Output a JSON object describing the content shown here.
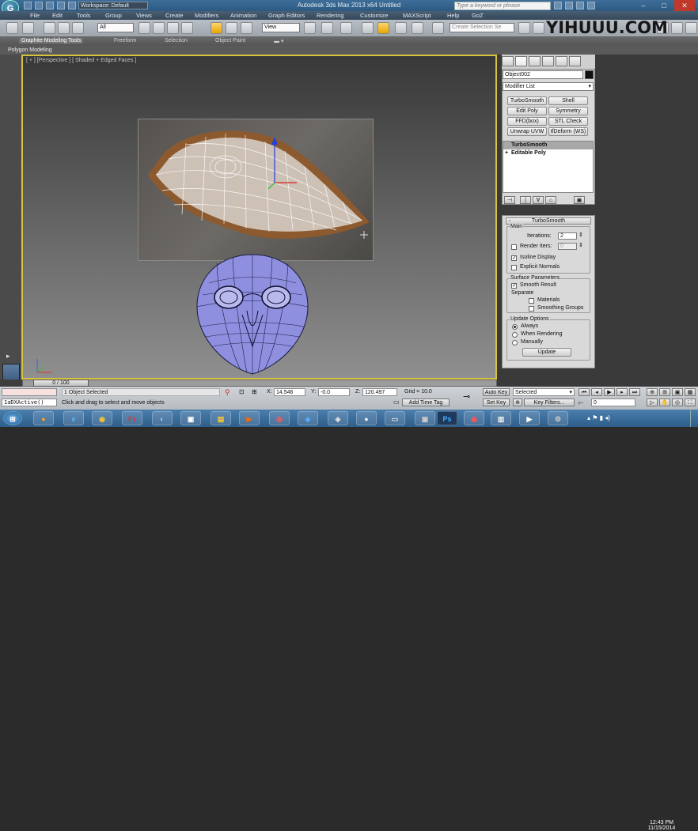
{
  "titlebar": {
    "title": "Autodesk 3ds Max  2013 x64      Untitled",
    "workspace": "Workspace: Default",
    "search_placeholder": "Type a keyword or phrase",
    "app_icon": "3ds-max-logo-icon"
  },
  "menus": [
    "File",
    "Edit",
    "Tools",
    "Group",
    "Views",
    "Create",
    "Modifiers",
    "Animation",
    "Graph Editors",
    "Rendering",
    "Customize",
    "MAXScript",
    "Help",
    "GoZ"
  ],
  "toolbar": {
    "selection_filter": "All",
    "ref_coord": "View",
    "named_selection_placeholder": "Create Selection Se"
  },
  "watermark": "YIHUUU.COM",
  "ribbon": {
    "tabs": [
      "Graphite Modeling Tools",
      "Freeform",
      "Selection",
      "Object Paint"
    ],
    "subtitle": "Polygon Modeling"
  },
  "viewport": {
    "label": "[ + ] [Perspective ] [ Shaded + Edged Faces ]"
  },
  "command_panel": {
    "object_name": "Object002",
    "object_color": "#111111",
    "modifier_list": "Modifier List",
    "modifier_buttons": [
      "TurboSmooth",
      "Shell",
      "Edit Poly",
      "Symmetry",
      "FFD(box)",
      "STL Check",
      "Unwrap UVW",
      "tfDeform (WS)"
    ],
    "stack": [
      "TurboSmooth",
      "Editable Poly"
    ],
    "rollout": {
      "title": "TurboSmooth",
      "main": "Main",
      "iterations_label": "Iterations:",
      "iterations": "2",
      "render_iters_label": "Render Iters:",
      "render_iters": "0",
      "isoline_display": "Isoline Display",
      "explicit_normals": "Explicit Normals",
      "surface_params": "Surface Parameters",
      "smooth_result": "Smooth Result",
      "separate": "Separate",
      "materials": "Materials",
      "smoothing_groups": "Smoothing Groups",
      "update_options": "Update Options",
      "always": "Always",
      "when_rendering": "When Rendering",
      "manually": "Manually",
      "update_button": "Update"
    }
  },
  "timeslider": {
    "label": "0 / 100"
  },
  "status": {
    "maxscript_listener": "1aDXActive()",
    "selected": "1 Object Selected",
    "prompt": "Click and drag to select and move objects",
    "x_label": "X:",
    "x": "14.546",
    "y_label": "Y:",
    "y": "-0.0",
    "z_label": "Z:",
    "z": "120.497",
    "grid": "Grid = 10.0",
    "add_time_tag": "Add Time Tag",
    "auto_key": "Auto Key",
    "selected_dropdown": "Selected",
    "set_key": "Set Key",
    "key_filters": "Key Filters...",
    "frame": "0"
  },
  "taskbar": {
    "time": "12:43 PM",
    "date": "11/15/2014"
  }
}
